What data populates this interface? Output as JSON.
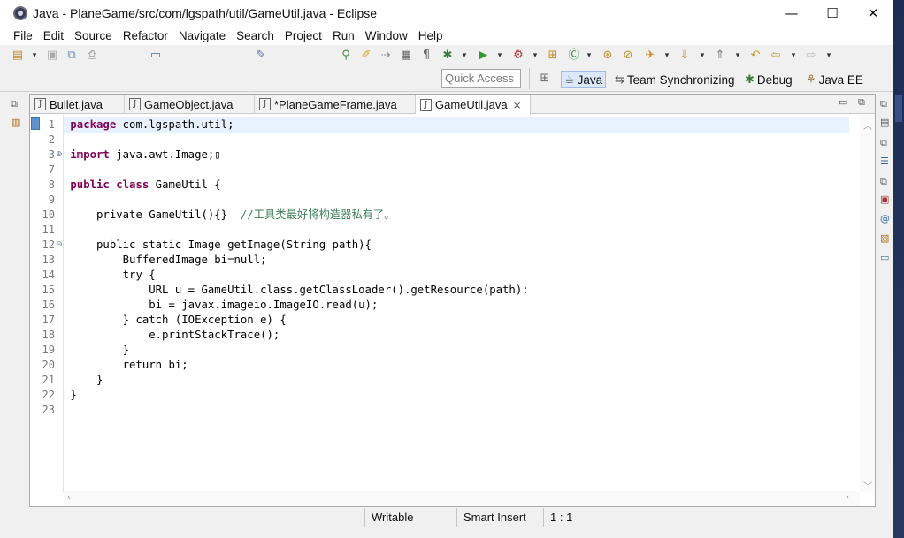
{
  "window": {
    "title": "Java - PlaneGame/src/com/lgspath/util/GameUtil.java - Eclipse",
    "minimize": "—",
    "maximize": "☐",
    "close": "✕"
  },
  "menubar": {
    "items": [
      "File",
      "Edit",
      "Source",
      "Refactor",
      "Navigate",
      "Search",
      "Project",
      "Run",
      "Window",
      "Help"
    ]
  },
  "toolbar": {
    "quick_access_placeholder": "Quick Access",
    "perspectives": [
      {
        "label": "Java",
        "icon": "java-perspective-icon",
        "active": true
      },
      {
        "label": "Team Synchronizing",
        "icon": "team-sync-icon",
        "active": false
      },
      {
        "label": "Debug",
        "icon": "debug-bug-icon",
        "active": false
      },
      {
        "label": "Java EE",
        "icon": "java-ee-icon",
        "active": false
      }
    ]
  },
  "editor": {
    "tabs": [
      {
        "label": "Bullet.java",
        "active": false
      },
      {
        "label": "GameObject.java",
        "active": false
      },
      {
        "label": "*PlaneGameFrame.java",
        "active": false
      },
      {
        "label": "GameUtil.java",
        "active": true,
        "close": "⨯"
      }
    ],
    "lines": [
      {
        "n": "1",
        "fold": "",
        "parts": [
          [
            "kw",
            "package"
          ],
          [
            "",
            "com.lgspath.util;"
          ]
        ]
      },
      {
        "n": "2",
        "fold": "",
        "parts": []
      },
      {
        "n": "3",
        "fold": "⊕",
        "parts": [
          [
            "kw",
            "import"
          ],
          [
            "",
            "java.awt.Image;▯"
          ]
        ]
      },
      {
        "n": "7",
        "fold": "",
        "parts": []
      },
      {
        "n": "8",
        "fold": "",
        "parts": [
          [
            "kw",
            "public"
          ],
          [
            "kw",
            "class"
          ],
          [
            "",
            "GameUtil {"
          ]
        ]
      },
      {
        "n": "9",
        "fold": "",
        "parts": []
      },
      {
        "n": "10",
        "fold": "",
        "parts": [
          [
            "",
            "    private GameUtil(){}  "
          ],
          [
            "cm",
            "//工具类最好将构造器私有了。"
          ]
        ]
      },
      {
        "n": "11",
        "fold": "",
        "parts": []
      },
      {
        "n": "12",
        "fold": "⊖",
        "parts": [
          [
            "",
            "    public static Image getImage(String path){"
          ]
        ]
      },
      {
        "n": "13",
        "fold": "",
        "parts": [
          [
            "",
            "        BufferedImage bi=null;"
          ]
        ]
      },
      {
        "n": "14",
        "fold": "",
        "parts": [
          [
            "",
            "        try {"
          ]
        ]
      },
      {
        "n": "15",
        "fold": "",
        "parts": [
          [
            "",
            "            URL u = GameUtil.class.getClassLoader().getResource(path);"
          ]
        ]
      },
      {
        "n": "16",
        "fold": "",
        "parts": [
          [
            "",
            "            bi = javax.imageio.ImageIO.read(u);"
          ]
        ]
      },
      {
        "n": "17",
        "fold": "",
        "parts": [
          [
            "",
            "        } catch (IOException e) {"
          ]
        ]
      },
      {
        "n": "18",
        "fold": "",
        "parts": [
          [
            "",
            "            e.printStackTrace();"
          ]
        ]
      },
      {
        "n": "19",
        "fold": "",
        "parts": [
          [
            "",
            "        }"
          ]
        ]
      },
      {
        "n": "20",
        "fold": "",
        "parts": [
          [
            "",
            "        return bi;"
          ]
        ]
      },
      {
        "n": "21",
        "fold": "",
        "parts": [
          [
            "",
            "    }"
          ]
        ]
      },
      {
        "n": "22",
        "fold": "",
        "parts": [
          [
            "",
            "}"
          ]
        ]
      },
      {
        "n": "23",
        "fold": "",
        "parts": []
      }
    ]
  },
  "statusbar": {
    "writable": "Writable",
    "insert_mode": "Smart Insert",
    "position": "1 : 1"
  },
  "colors": {
    "keyword": "#7f0055",
    "comment": "#3f7f5f",
    "current_line": "#e8f2fe",
    "active_perspective": "#dbe8f8"
  }
}
